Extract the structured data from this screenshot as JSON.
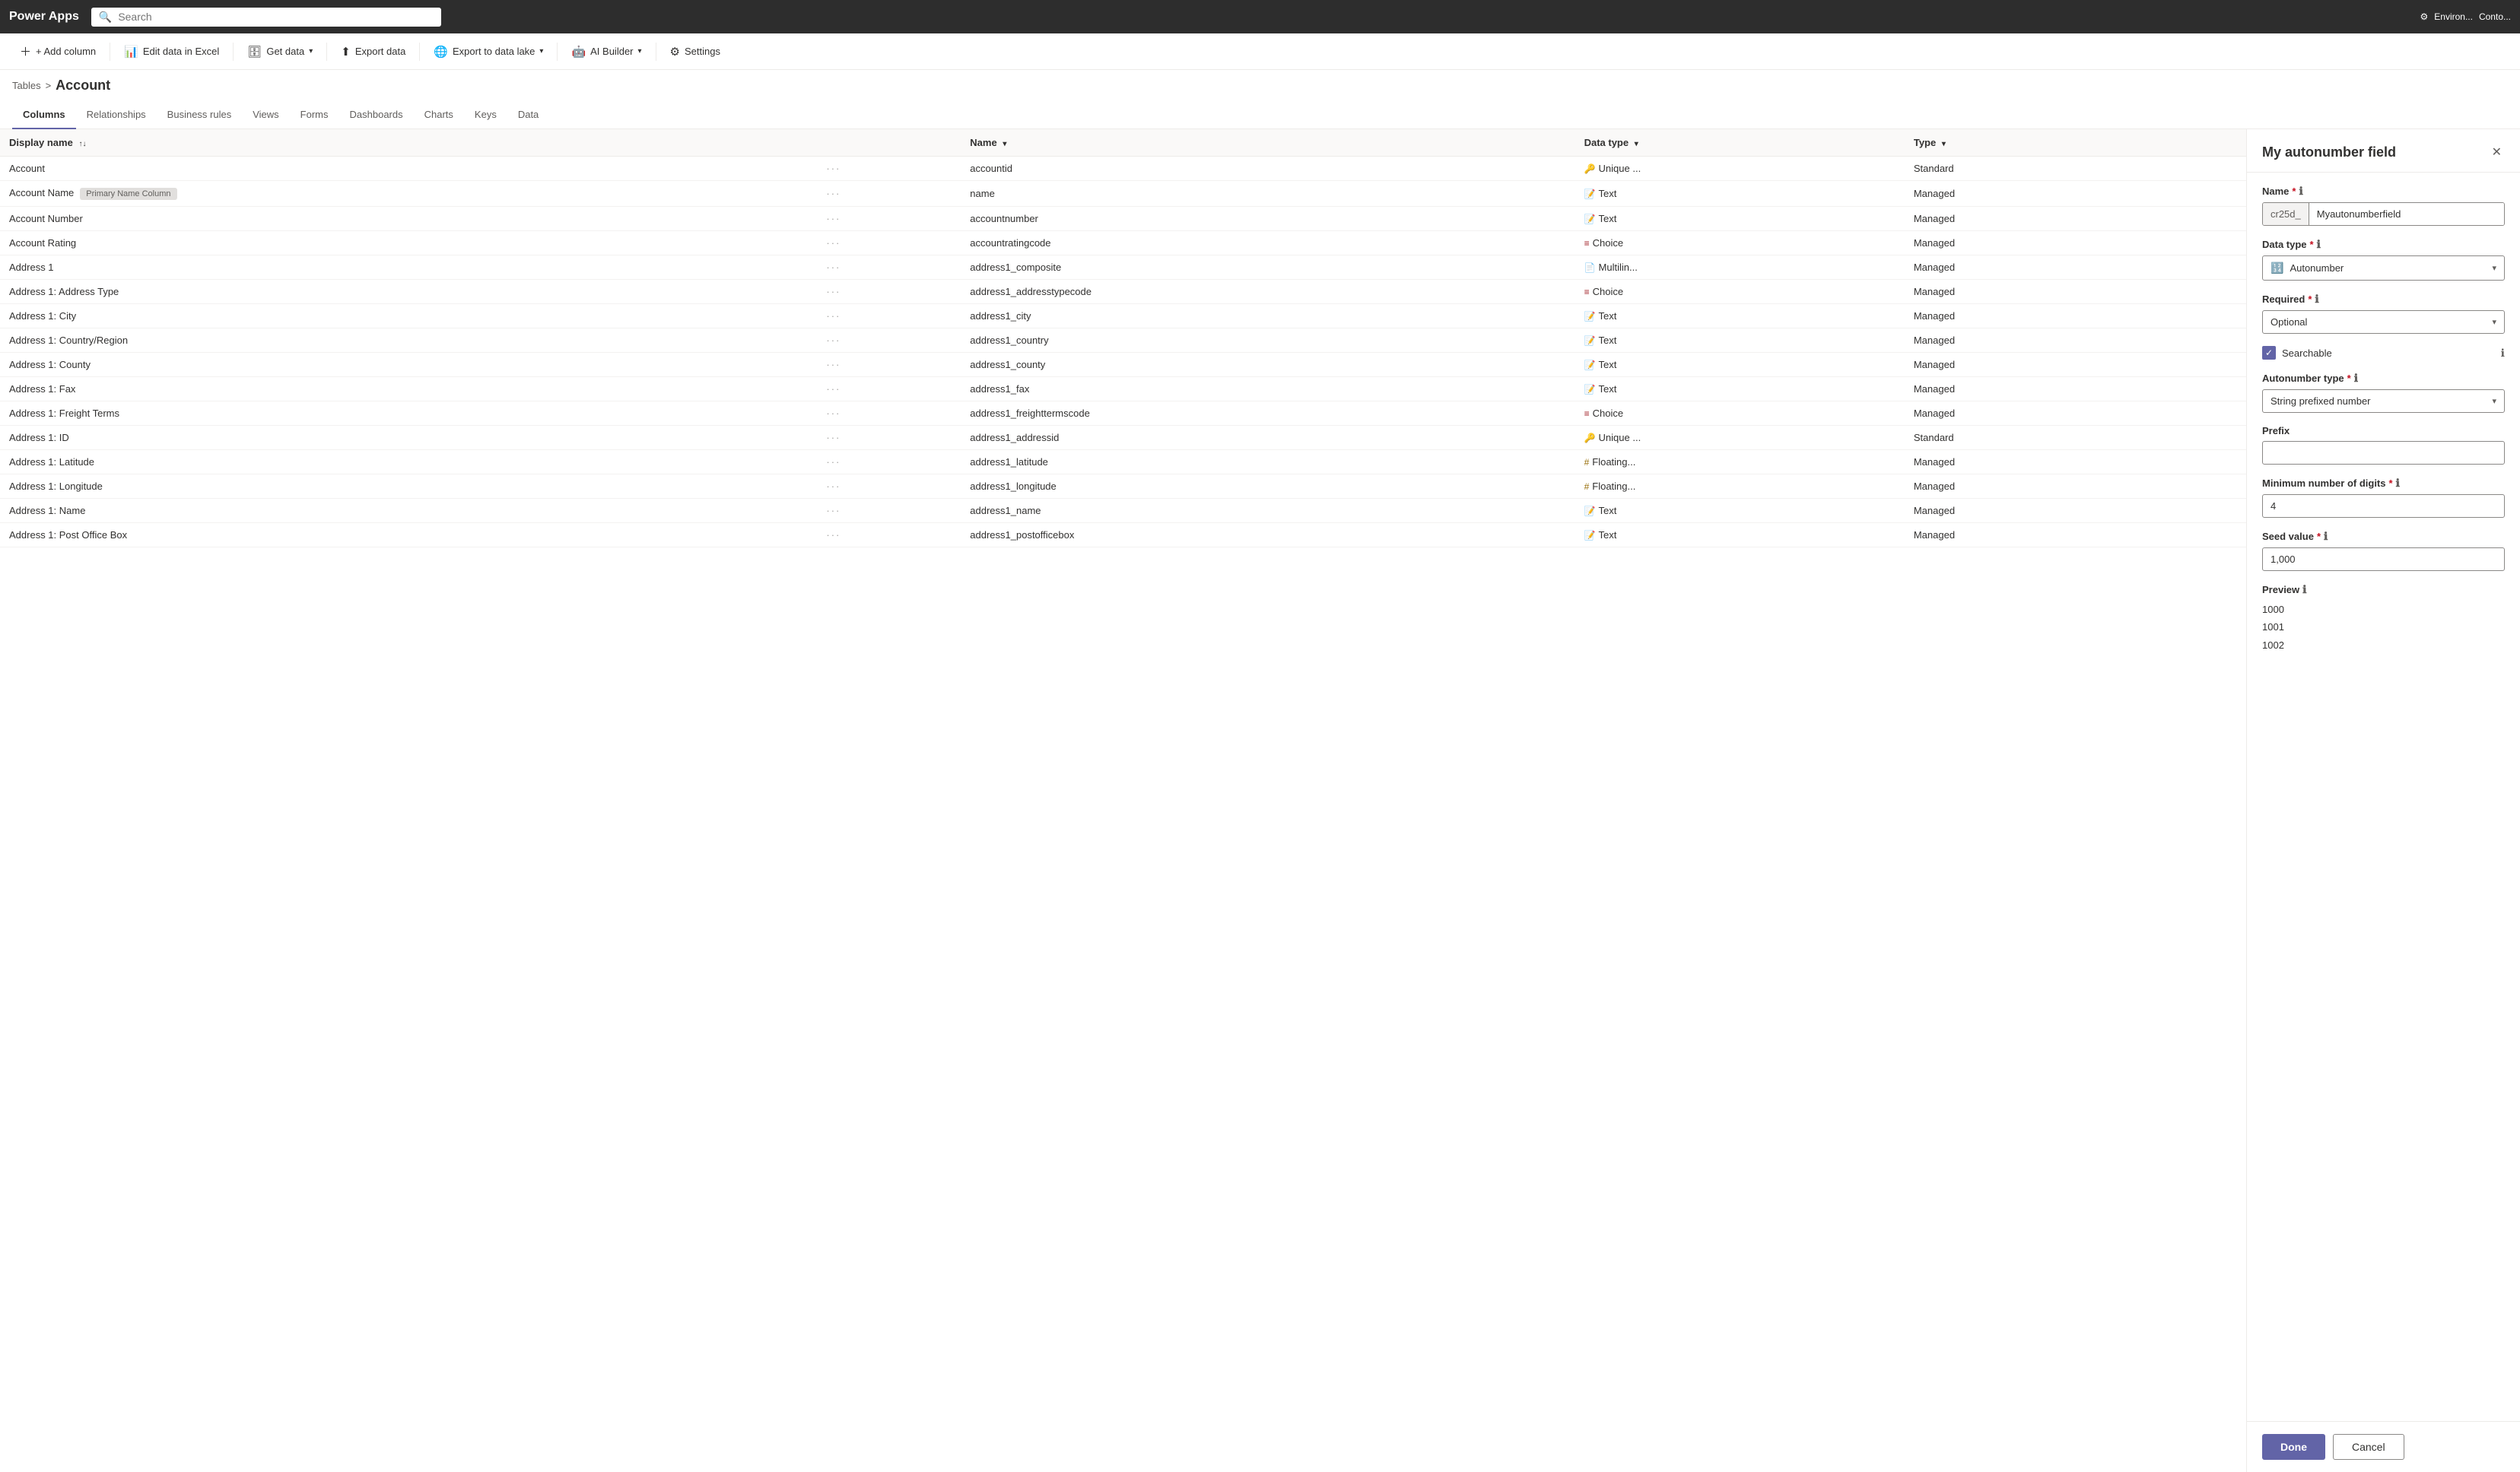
{
  "topbar": {
    "logo": "Power Apps",
    "search_placeholder": "Search",
    "env_label": "Environ...",
    "user_label": "Conto..."
  },
  "toolbar": {
    "add_column": "+ Add column",
    "edit_excel": "Edit data in Excel",
    "get_data": "Get data",
    "export_data": "Export data",
    "export_lake": "Export to data lake",
    "ai_builder": "AI Builder",
    "settings": "Settings"
  },
  "breadcrumb": {
    "tables": "Tables",
    "separator": ">",
    "current": "Account"
  },
  "tabs": [
    "Columns",
    "Relationships",
    "Business rules",
    "Views",
    "Forms",
    "Dashboards",
    "Charts",
    "Keys",
    "Data"
  ],
  "active_tab": "Columns",
  "table": {
    "columns": [
      "Display name",
      "",
      "Name",
      "Data type",
      "Type",
      ""
    ],
    "rows": [
      {
        "display": "Account",
        "name": "accountid",
        "data_type": "Unique ...",
        "type": "Standard",
        "dt_class": "dt-unique",
        "dt_icon": "🔑"
      },
      {
        "display": "Account Name",
        "badge": "Primary Name Column",
        "name": "name",
        "data_type": "Text",
        "type": "Managed",
        "dt_class": "dt-text",
        "dt_icon": "📝"
      },
      {
        "display": "Account Number",
        "name": "accountnumber",
        "data_type": "Text",
        "type": "Managed",
        "dt_class": "dt-text",
        "dt_icon": "📝"
      },
      {
        "display": "Account Rating",
        "name": "accountratingcode",
        "data_type": "Choice",
        "type": "Managed",
        "dt_class": "dt-choice",
        "dt_icon": "≡"
      },
      {
        "display": "Address 1",
        "name": "address1_composite",
        "data_type": "Multilin...",
        "type": "Managed",
        "dt_class": "dt-multiline",
        "dt_icon": "📄"
      },
      {
        "display": "Address 1: Address Type",
        "name": "address1_addresstypecode",
        "data_type": "Choice",
        "type": "Managed",
        "dt_class": "dt-choice",
        "dt_icon": "≡"
      },
      {
        "display": "Address 1: City",
        "name": "address1_city",
        "data_type": "Text",
        "type": "Managed",
        "dt_class": "dt-text",
        "dt_icon": "📝"
      },
      {
        "display": "Address 1: Country/Region",
        "name": "address1_country",
        "data_type": "Text",
        "type": "Managed",
        "dt_class": "dt-text",
        "dt_icon": "📝"
      },
      {
        "display": "Address 1: County",
        "name": "address1_county",
        "data_type": "Text",
        "type": "Managed",
        "dt_class": "dt-text",
        "dt_icon": "📝"
      },
      {
        "display": "Address 1: Fax",
        "name": "address1_fax",
        "data_type": "Text",
        "type": "Managed",
        "dt_class": "dt-text",
        "dt_icon": "📝"
      },
      {
        "display": "Address 1: Freight Terms",
        "name": "address1_freighttermscode",
        "data_type": "Choice",
        "type": "Managed",
        "dt_class": "dt-choice",
        "dt_icon": "≡"
      },
      {
        "display": "Address 1: ID",
        "name": "address1_addressid",
        "data_type": "Unique ...",
        "type": "Standard",
        "dt_class": "dt-unique",
        "dt_icon": "🔑"
      },
      {
        "display": "Address 1: Latitude",
        "name": "address1_latitude",
        "data_type": "Floating...",
        "type": "Managed",
        "dt_class": "dt-float",
        "dt_icon": "#"
      },
      {
        "display": "Address 1: Longitude",
        "name": "address1_longitude",
        "data_type": "Floating...",
        "type": "Managed",
        "dt_class": "dt-float",
        "dt_icon": "#"
      },
      {
        "display": "Address 1: Name",
        "name": "address1_name",
        "data_type": "Text",
        "type": "Managed",
        "dt_class": "dt-text",
        "dt_icon": "📝"
      },
      {
        "display": "Address 1: Post Office Box",
        "name": "address1_postofficebox",
        "data_type": "Text",
        "type": "Managed",
        "dt_class": "dt-text",
        "dt_icon": "📝"
      }
    ]
  },
  "panel": {
    "title": "My autonumber field",
    "close_icon": "✕",
    "name_label": "Name",
    "name_prefix": "cr25d_",
    "name_value": "Myautonumberfield",
    "data_type_label": "Data type",
    "data_type_value": "Autonumber",
    "data_type_icon": "🔢",
    "required_label": "Required",
    "required_value": "Optional",
    "searchable_label": "Searchable",
    "searchable_checked": true,
    "autonumber_type_label": "Autonumber type",
    "autonumber_type_value": "String prefixed number",
    "prefix_label": "Prefix",
    "prefix_value": "",
    "min_digits_label": "Minimum number of digits",
    "min_digits_value": "4",
    "seed_label": "Seed value",
    "seed_value": "1,000",
    "preview_label": "Preview",
    "preview_values": [
      "1000",
      "1001",
      "1002"
    ],
    "done_label": "Done",
    "cancel_label": "Cancel"
  }
}
